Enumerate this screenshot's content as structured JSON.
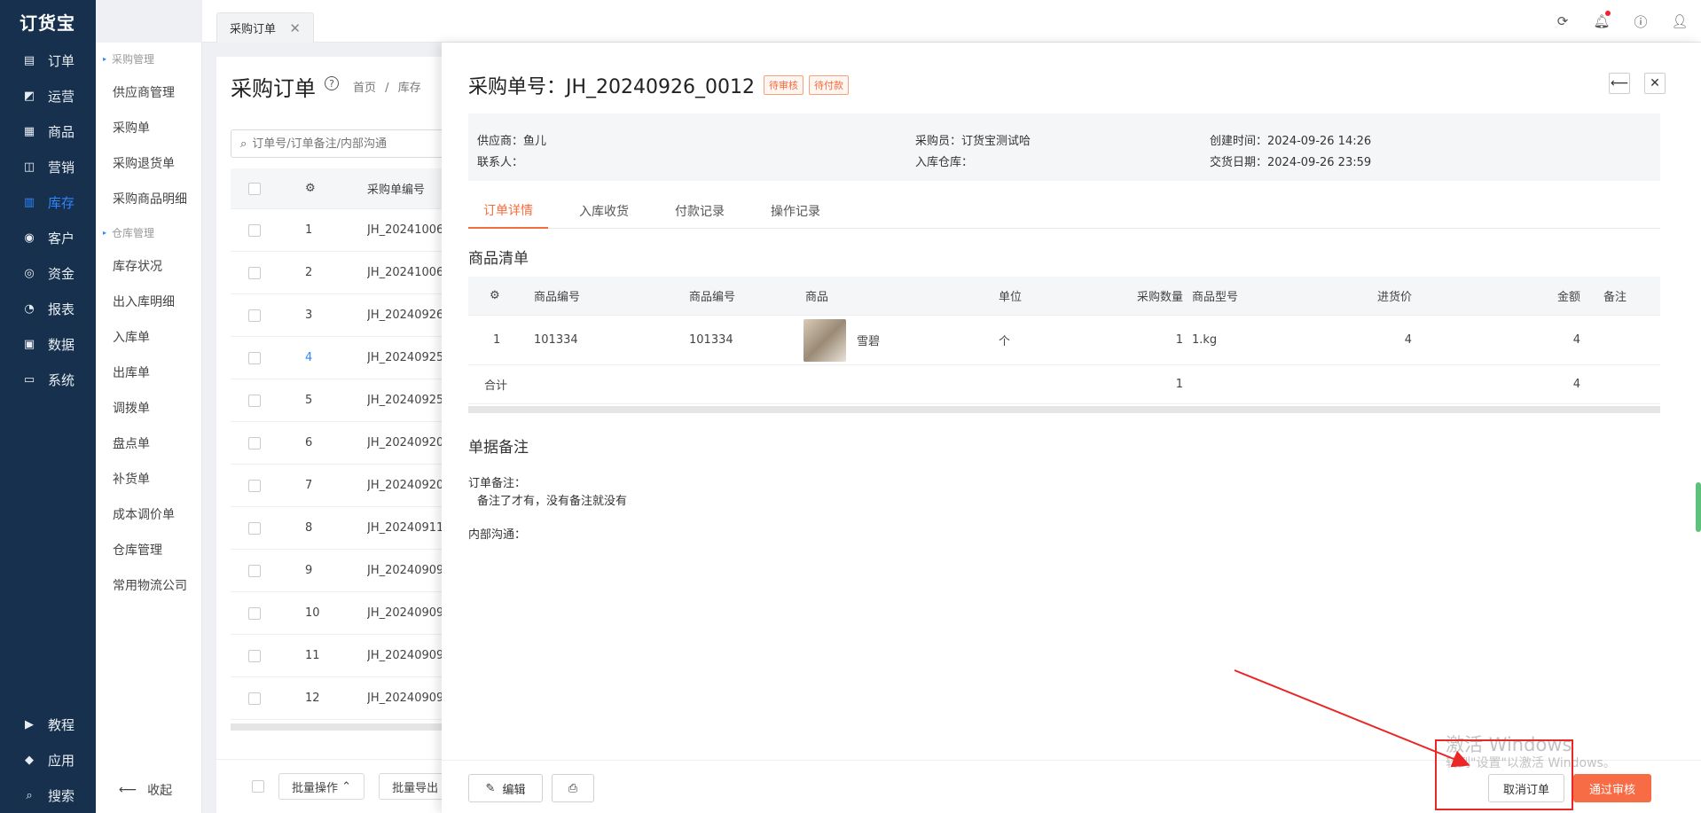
{
  "app": {
    "logo": "订货宝"
  },
  "nav": {
    "items": [
      {
        "label": "订单",
        "icon": "order-icon",
        "glyph": "▤"
      },
      {
        "label": "运营",
        "icon": "operation-icon",
        "glyph": "◩"
      },
      {
        "label": "商品",
        "icon": "goods-icon",
        "glyph": "▦"
      },
      {
        "label": "营销",
        "icon": "marketing-icon",
        "glyph": "◫"
      },
      {
        "label": "库存",
        "icon": "inventory-icon",
        "glyph": "▥",
        "active": true
      },
      {
        "label": "客户",
        "icon": "customer-icon",
        "glyph": "◉"
      },
      {
        "label": "资金",
        "icon": "funds-icon",
        "glyph": "◎"
      },
      {
        "label": "报表",
        "icon": "report-icon",
        "glyph": "◔"
      },
      {
        "label": "数据",
        "icon": "data-icon",
        "glyph": "▣"
      },
      {
        "label": "系统",
        "icon": "system-icon",
        "glyph": "▭"
      }
    ],
    "bottom": [
      {
        "label": "教程",
        "icon": "tutorial-icon",
        "glyph": "▶"
      },
      {
        "label": "应用",
        "icon": "app-icon",
        "glyph": "◆"
      },
      {
        "label": "搜索",
        "icon": "search-icon",
        "glyph": "⌕"
      }
    ]
  },
  "submenu": {
    "group1": "采购管理",
    "items1": [
      "供应商管理",
      "采购单",
      "采购退货单",
      "采购商品明细"
    ],
    "group2": "仓库管理",
    "items2": [
      "库存状况",
      "出入库明细",
      "入库单",
      "出库单",
      "调拨单",
      "盘点单",
      "补货单",
      "成本调价单",
      "仓库管理",
      "常用物流公司"
    ],
    "collapse": "收起"
  },
  "topbar": {
    "tab_label": "采购订单"
  },
  "list": {
    "title": "采购订单",
    "breadcrumb": [
      "首页",
      "库存"
    ],
    "search_placeholder": "订单号/订单备注/内部沟通",
    "col_no": "采购单编号",
    "rows": [
      {
        "idx": "1",
        "no": "JH_20241006_"
      },
      {
        "idx": "2",
        "no": "JH_20241006_"
      },
      {
        "idx": "3",
        "no": "JH_20240926_"
      },
      {
        "idx": "4",
        "no": "JH_20240925_",
        "highlight": true
      },
      {
        "idx": "5",
        "no": "JH_20240925_"
      },
      {
        "idx": "6",
        "no": "JH_20240920_"
      },
      {
        "idx": "7",
        "no": "JH_20240920_"
      },
      {
        "idx": "8",
        "no": "JH_20240911_"
      },
      {
        "idx": "9",
        "no": "JH_20240909_"
      },
      {
        "idx": "10",
        "no": "JH_20240909_"
      },
      {
        "idx": "11",
        "no": "JH_20240909_"
      },
      {
        "idx": "12",
        "no": "JH_20240909_"
      }
    ],
    "batch_op": "批量操作",
    "batch_export": "批量导出"
  },
  "drawer": {
    "title": "采购单号：JH_20240926_0012",
    "tags": [
      "待审核",
      "待付款"
    ],
    "info": {
      "supplier": "供应商：鱼儿",
      "contact": "联系人：",
      "buyer": "采购员：订货宝测试哈",
      "warehouse": "入库仓库：",
      "created": "创建时间：2024-09-26 14:26",
      "delivery": "交货日期：2024-09-26 23:59"
    },
    "tabs": [
      "订单详情",
      "入库收货",
      "付款记录",
      "操作记录"
    ],
    "goods_title": "商品清单",
    "columns": [
      "商品编号",
      "商品编号",
      "商品",
      "单位",
      "采购数量",
      "商品型号",
      "进货价",
      "金额",
      "备注"
    ],
    "goods": [
      {
        "idx": "1",
        "code1": "101334",
        "code2": "101334",
        "name": "雪碧",
        "unit": "个",
        "qty": "1",
        "model": "1.kg",
        "price": "4",
        "amount": "4",
        "note": ""
      }
    ],
    "sum": {
      "label": "合计",
      "qty": "1",
      "amount": "4"
    },
    "remark_title": "单据备注",
    "order_note_label": "订单备注：",
    "order_note": "备注了才有，没有备注就没有",
    "internal_label": "内部沟通：",
    "edit": "编辑",
    "cancel_order": "取消订单",
    "approve": "通过审核"
  },
  "watermark": {
    "line1": "激活 Windows",
    "line2": "转到\"设置\"以激活 Windows。"
  }
}
